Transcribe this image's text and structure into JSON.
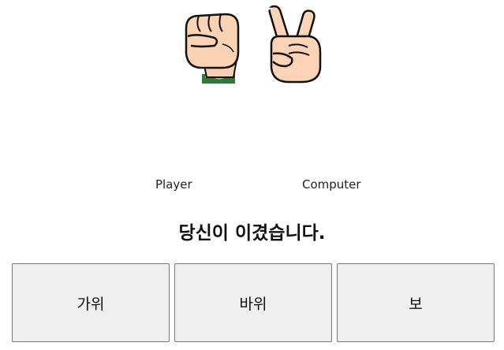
{
  "player": {
    "label": "Player",
    "hand": "rock-fist-icon"
  },
  "computer": {
    "label": "Computer",
    "hand": "scissors-peace-sign-icon"
  },
  "result": {
    "message": "당신이 이겼습니다."
  },
  "choices": [
    {
      "label": "가위"
    },
    {
      "label": "바위"
    },
    {
      "label": "보"
    }
  ]
}
